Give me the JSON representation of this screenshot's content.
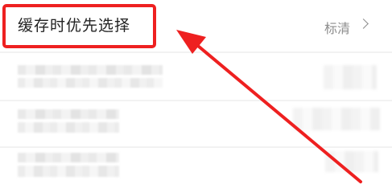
{
  "settings": {
    "cache_priority": {
      "label": "缓存时优先选择",
      "value": "标清"
    }
  },
  "colors": {
    "annotation": "#ee2020",
    "label": "#222222",
    "value": "#8d8d8d"
  },
  "icons": {
    "chevron": "chevron-right-icon"
  }
}
